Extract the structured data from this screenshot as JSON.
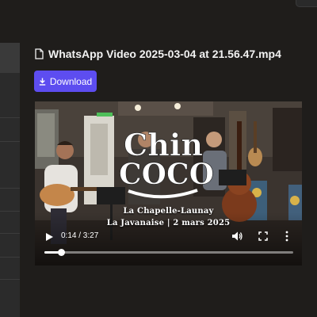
{
  "file": {
    "name": "WhatsApp Video 2025-03-04 at 21.56.47.mp4",
    "icon": "file-icon"
  },
  "download": {
    "label": "Download",
    "icon": "download-icon"
  },
  "video": {
    "title_line1": "Chin",
    "title_line2": "COCO",
    "subtitle_line1": "La Chapelle-Launay",
    "subtitle_line2": "La Javanaise | 2 mars 2025",
    "current_time": "0:14",
    "duration": "3:27",
    "time_display": "0:14 / 3:27",
    "progress_fraction": 0.07
  },
  "colors": {
    "background": "#1f1d1b",
    "accent": "#5d4df0"
  }
}
